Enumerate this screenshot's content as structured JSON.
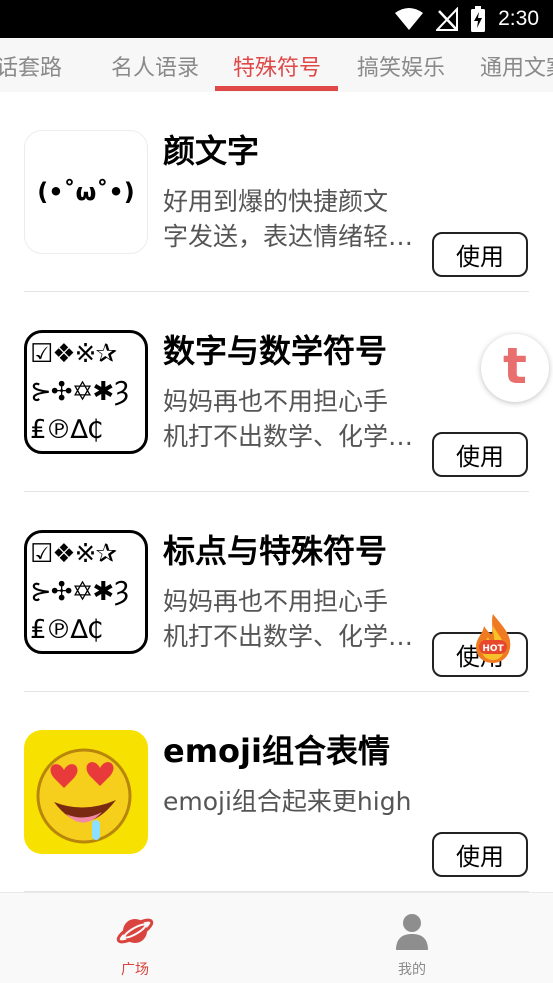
{
  "status_bar": {
    "time": "2:30",
    "icons": [
      "wifi-icon",
      "no-signal-icon",
      "battery-charging-icon"
    ]
  },
  "tabs": [
    {
      "label": "对话套路",
      "active": false
    },
    {
      "label": "名人语录",
      "active": false
    },
    {
      "label": "特殊符号",
      "active": true
    },
    {
      "label": "搞笑娱乐",
      "active": false
    },
    {
      "label": "通用文案",
      "active": false
    }
  ],
  "items": [
    {
      "title": "颜文字",
      "thumb_text": "(•˚ω˚•)",
      "desc_line1": "好用到爆的快捷颜文",
      "desc_line2": "字发送，表达情绪轻…",
      "button": "使用"
    },
    {
      "title": "数字与数学符号",
      "thumb_rows": [
        "☑❖※✰",
        "⊱✣✡✱Ȝ",
        "₤℗∆₵"
      ],
      "desc_line1": "妈妈再也不用担心手",
      "desc_line2": "机打不出数学、化学…",
      "button": "使用"
    },
    {
      "title": "标点与特殊符号",
      "thumb_rows": [
        "☑❖※✰",
        "⊱✣✡✱Ȝ",
        "₤℗∆₵"
      ],
      "desc_line1": "妈妈再也不用担心手",
      "desc_line2": "机打不出数学、化学…",
      "button": "使用"
    },
    {
      "title": "emoji组合表情",
      "desc_line1": "emoji组合起来更high",
      "button": "使用",
      "badge": "HOT"
    }
  ],
  "floating_button": {
    "letter": "t"
  },
  "bottom_nav": [
    {
      "label": "广场",
      "icon": "planet-icon",
      "active": true
    },
    {
      "label": "我的",
      "icon": "person-icon",
      "active": false
    }
  ],
  "colors": {
    "accent": "#e04848",
    "float_letter": "#e96f6f",
    "emoji_bg": "#f7e100"
  }
}
